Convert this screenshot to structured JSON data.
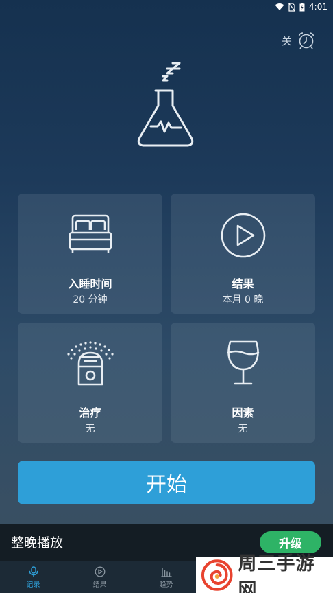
{
  "status_bar": {
    "time": "4:01"
  },
  "alarm": {
    "label": "关",
    "icon": "alarm-clock-icon"
  },
  "hero": {
    "icon": "sleep-flask-icon"
  },
  "tiles": [
    {
      "title": "入睡时间",
      "subtitle": "20 分钟",
      "icon": "bed-icon"
    },
    {
      "title": "结果",
      "subtitle": "本月 0 晚",
      "icon": "play-circle-icon"
    },
    {
      "title": "治疗",
      "subtitle": "无",
      "icon": "diffuser-icon"
    },
    {
      "title": "因素",
      "subtitle": "无",
      "icon": "wine-glass-icon"
    }
  ],
  "start_button": {
    "label": "开始"
  },
  "promo": {
    "text": "整晚播放",
    "upgrade_label": "升级"
  },
  "nav": [
    {
      "label": "记录",
      "icon": "microphone-icon",
      "active": true
    },
    {
      "label": "结果",
      "icon": "play-circle-icon",
      "active": false
    },
    {
      "label": "趋势",
      "icon": "bar-chart-icon",
      "active": false
    }
  ],
  "watermark": {
    "text": "周三手游网"
  },
  "colors": {
    "accent": "#2e9fd8",
    "upgrade": "#2eb366",
    "nav_active": "#2e9fd8",
    "nav_inactive": "#8a96a0"
  }
}
